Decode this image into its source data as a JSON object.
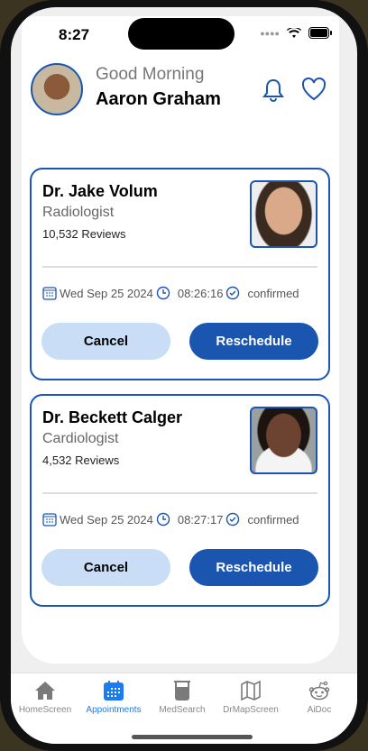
{
  "status": {
    "time": "8:27"
  },
  "header": {
    "greeting": "Good Morning",
    "user_name": "Aaron Graham"
  },
  "appointments": [
    {
      "doctor": "Dr. Jake Volum",
      "specialty": "Radiologist",
      "reviews": "10,532 Reviews",
      "date": "Wed Sep 25 2024",
      "time": "08:26:16",
      "status": "confirmed",
      "cancel_label": "Cancel",
      "reschedule_label": "Reschedule"
    },
    {
      "doctor": "Dr. Beckett Calger",
      "specialty": "Cardiologist",
      "reviews": "4,532 Reviews",
      "date": "Wed Sep 25 2024",
      "time": "08:27:17",
      "status": "confirmed",
      "cancel_label": "Cancel",
      "reschedule_label": "Reschedule"
    }
  ],
  "tabs": [
    {
      "label": "HomeScreen"
    },
    {
      "label": "Appointments",
      "active": true
    },
    {
      "label": "MedSearch"
    },
    {
      "label": "DrMapScreen"
    },
    {
      "label": "AiDoc"
    }
  ],
  "colors": {
    "accent": "#1a56b0",
    "active_tab": "#1a7cf0"
  }
}
